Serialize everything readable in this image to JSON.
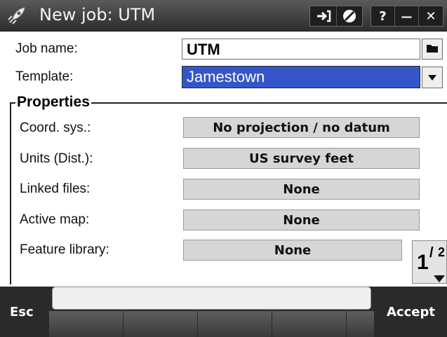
{
  "window": {
    "title": "New job: UTM",
    "app_icon": "rocket-icon",
    "buttons": [
      "arrow-right-icon",
      "cancel-icon",
      "help-icon",
      "minimize-icon",
      "close-icon"
    ],
    "help_label": "?",
    "minimize_label": "—",
    "close_label": "✕"
  },
  "form": {
    "job_name": {
      "label": "Job name:",
      "value": "UTM"
    },
    "template": {
      "label": "Template:",
      "value": "Jamestown"
    }
  },
  "properties": {
    "title": "Properties",
    "items": [
      {
        "label": "Coord. sys.:",
        "value": "No projection / no datum"
      },
      {
        "label": "Units (Dist.):",
        "value": "US survey feet"
      },
      {
        "label": "Linked files:",
        "value": "None"
      },
      {
        "label": "Active map:",
        "value": "None"
      },
      {
        "label": "Feature library:",
        "value": "None"
      }
    ]
  },
  "pager": {
    "current": "1",
    "total": "2",
    "separator": "/"
  },
  "footer": {
    "esc_label": "Esc",
    "accept_label": "Accept",
    "status_text": ""
  },
  "colors": {
    "select_bg": "#3556c9",
    "titlebar": "#3a3a3a",
    "bottombar": "#2a2a2a"
  }
}
